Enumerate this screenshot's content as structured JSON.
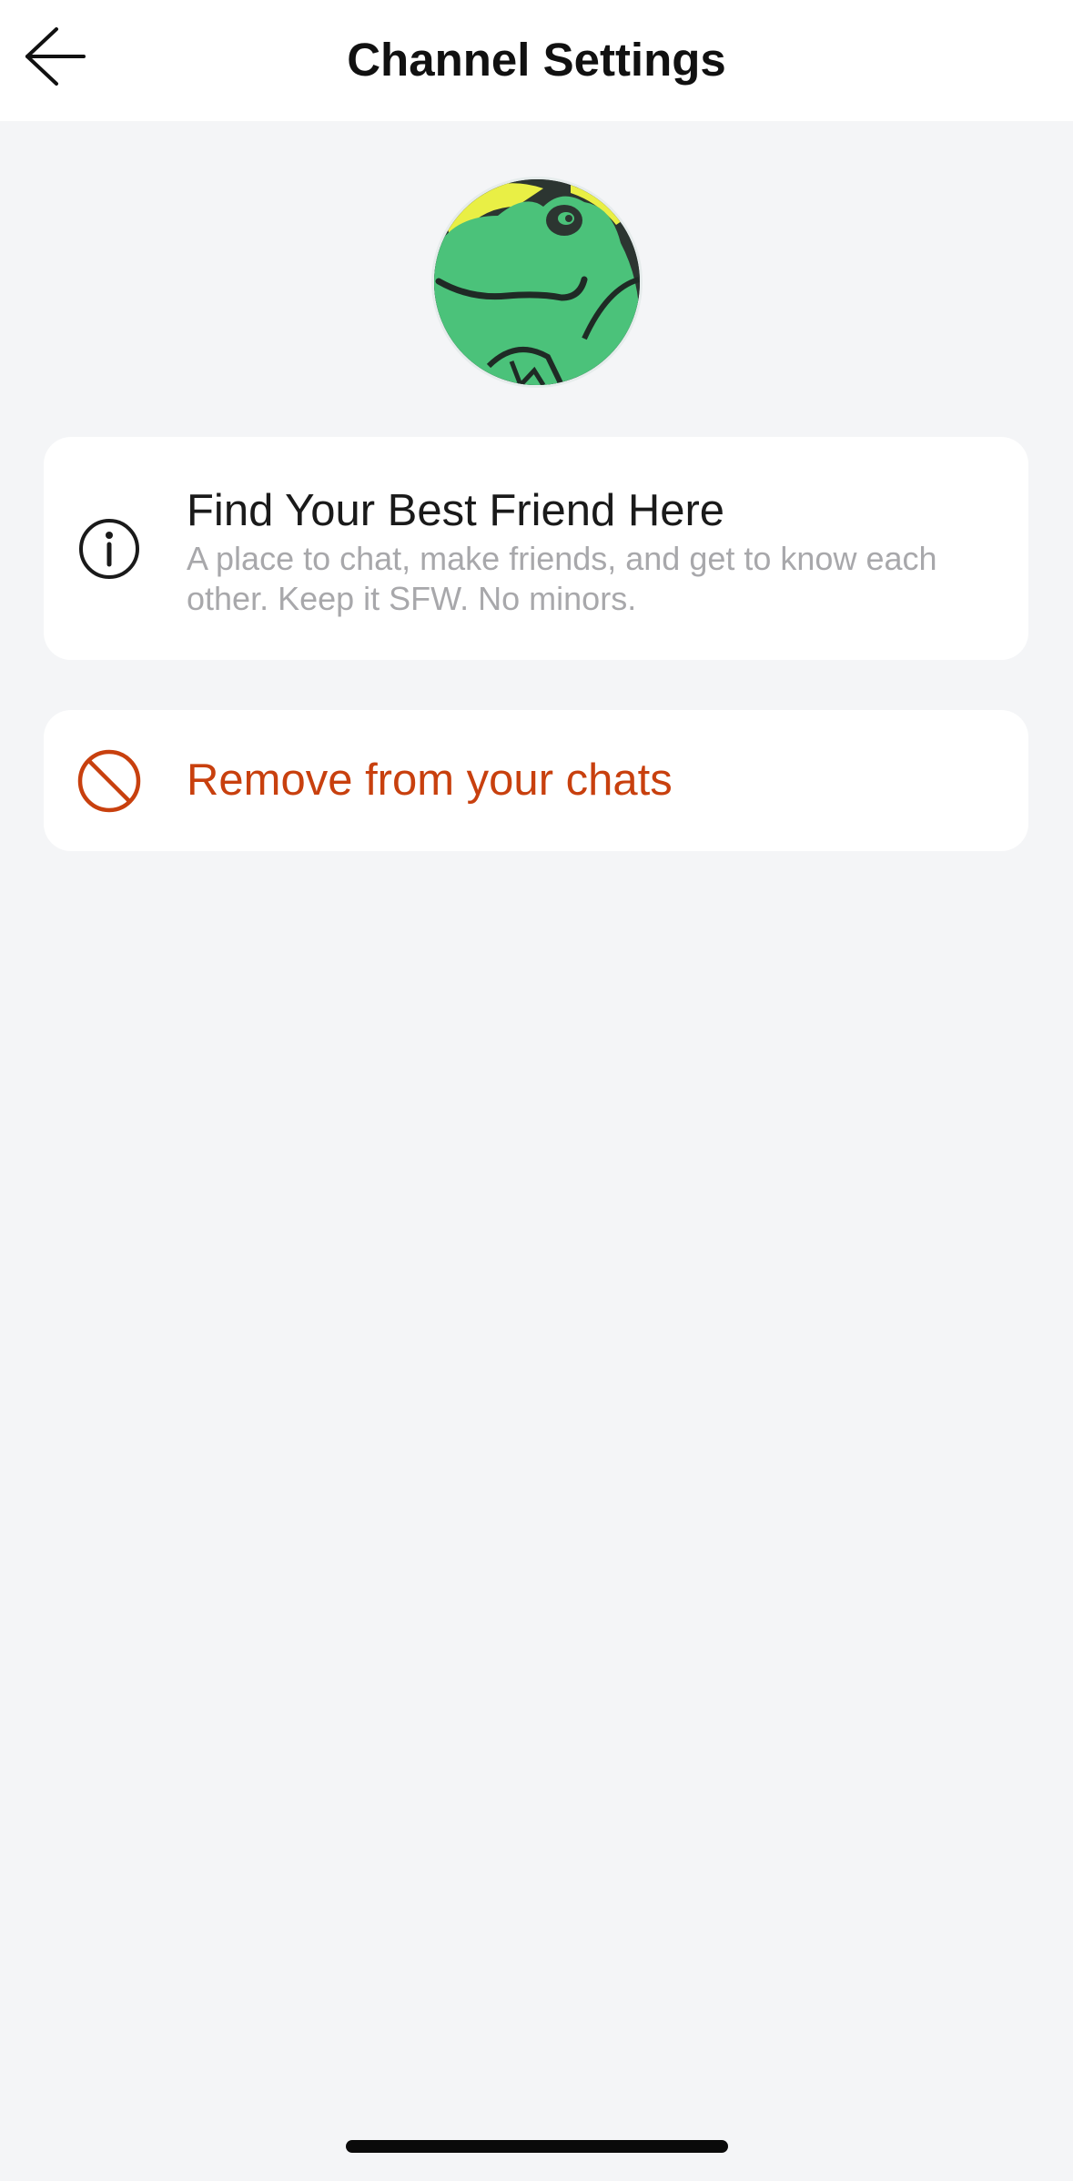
{
  "header": {
    "title": "Channel Settings",
    "back_icon": "arrow-left-icon"
  },
  "channel": {
    "avatar_alt": "frog-avatar"
  },
  "info_card": {
    "icon": "info-icon",
    "title": "Find Your Best Friend Here",
    "description": "A place to chat, make friends, and get to know each other. Keep it SFW. No minors."
  },
  "remove_card": {
    "icon": "prohibited-icon",
    "label": "Remove from your chats"
  },
  "colors": {
    "background": "#f4f5f7",
    "card": "#ffffff",
    "destructive": "#c8400e",
    "muted_text": "#a8a8ab"
  }
}
